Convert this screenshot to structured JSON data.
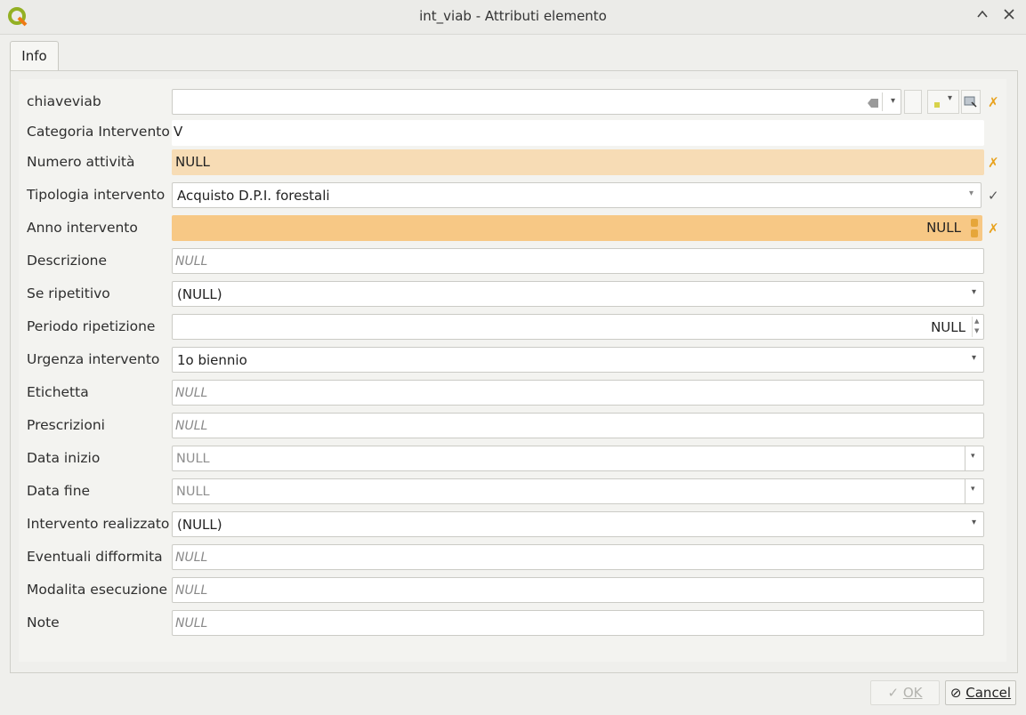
{
  "window": {
    "title": "int_viab - Attributi elemento",
    "app_icon": "qgis-logo-icon",
    "controls": [
      "chevron-up-icon",
      "close-icon"
    ]
  },
  "tabs": [
    {
      "label": "Info",
      "active": true
    }
  ],
  "colors": {
    "orange_field": "#f7c885",
    "light_orange_field": "#f7dcb5",
    "status_x": "#e8a21e"
  },
  "fields": {
    "chiaveviab": {
      "label": "chiaveviab",
      "value": "",
      "status": "x"
    },
    "categoria": {
      "label": "Categoria Intervento",
      "value": "V"
    },
    "numero": {
      "label": "Numero attività",
      "value": "NULL",
      "status": "x"
    },
    "tipologia": {
      "label": "Tipologia intervento",
      "value": "Acquisto D.P.I. forestali",
      "status": "ok"
    },
    "anno": {
      "label": "Anno intervento",
      "value": "NULL",
      "status": "x"
    },
    "descrizione": {
      "label": "Descrizione",
      "placeholder": "NULL"
    },
    "ripetitivo": {
      "label": "Se ripetitivo",
      "value": "(NULL)"
    },
    "periodo": {
      "label": "Periodo ripetizione",
      "value": "NULL"
    },
    "urgenza": {
      "label": "Urgenza intervento",
      "value": "1o biennio"
    },
    "etichetta": {
      "label": "Etichetta",
      "placeholder": "NULL"
    },
    "prescrizioni": {
      "label": "Prescrizioni",
      "placeholder": "NULL"
    },
    "data_inizio": {
      "label": "Data inizio",
      "value": "NULL"
    },
    "data_fine": {
      "label": "Data fine",
      "value": "NULL"
    },
    "realizzato": {
      "label": "Intervento realizzato",
      "value": "(NULL)"
    },
    "difformita": {
      "label": "Eventuali difformita",
      "placeholder": "NULL"
    },
    "modalita": {
      "label": "Modalita esecuzione",
      "placeholder": "NULL"
    },
    "note": {
      "label": "Note",
      "placeholder": "NULL"
    }
  },
  "footer": {
    "ok_label": "OK",
    "cancel_label": "Cancel"
  }
}
